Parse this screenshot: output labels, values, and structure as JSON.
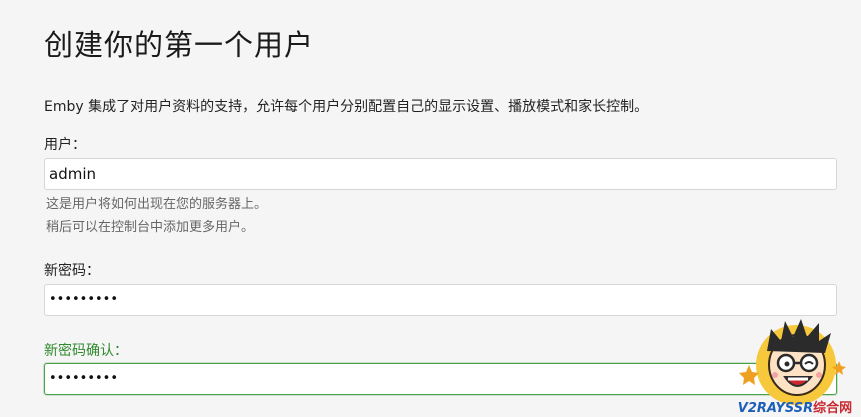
{
  "page": {
    "title": "创建你的第一个用户",
    "intro": "Emby 集成了对用户资料的支持，允许每个用户分别配置自己的显示设置、播放模式和家长控制。"
  },
  "form": {
    "username": {
      "label": "用户：",
      "value": "admin",
      "hint1": "这是用户将如何出现在您的服务器上。",
      "hint2": "稍后可以在控制台中添加更多用户。"
    },
    "password": {
      "label": "新密码：",
      "value": "•••••••••"
    },
    "password_confirm": {
      "label": "新密码确认：",
      "value": "•••••••••"
    }
  },
  "watermark": {
    "text_latin": "V2RAYSSR",
    "text_cn": "综合网",
    "icon": "cartoon-mascot-icon"
  },
  "colors": {
    "background": "#f5f5f5",
    "valid_green": "#2f8a2f",
    "input_border": "#d6d6d6"
  }
}
